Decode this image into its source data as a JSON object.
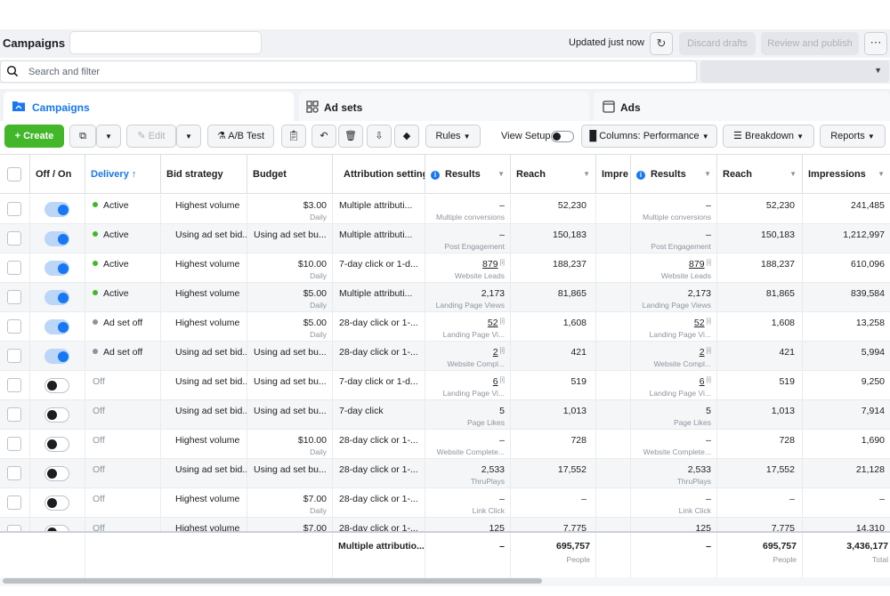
{
  "header": {
    "title": "Campaigns",
    "status": "Updated just now",
    "discard_label": "Discard drafts",
    "review_label": "Review and publish"
  },
  "search": {
    "placeholder": "Search and filter"
  },
  "tabs": [
    {
      "label": "Campaigns",
      "icon": "folder-icon",
      "active": true
    },
    {
      "label": "Ad sets",
      "icon": "grid-icon",
      "active": false
    },
    {
      "label": "Ads",
      "icon": "ad-icon",
      "active": false
    }
  ],
  "toolbar": {
    "create_label": "+ Create",
    "edit_label": "Edit",
    "ab_test_label": "A/B Test",
    "rules_label": "Rules",
    "view_setup_label": "View Setup",
    "columns_label": "Columns: Performance",
    "breakdown_label": "Breakdown",
    "reports_label": "Reports"
  },
  "columns": [
    "Off / On",
    "Delivery",
    "Bid strategy",
    "Budget",
    "Attribution setting",
    "Results",
    "Reach",
    "Impre",
    "Results",
    "Reach",
    "Impressions"
  ],
  "colors": {
    "accent": "#1877f2",
    "create": "#42b72a",
    "active_dot": "#42b72a",
    "off_dot": "#8d949e"
  },
  "rows": [
    {
      "on": true,
      "delivery": "Active",
      "bid": "Highest volume",
      "budget": "$3.00",
      "budget_sub": "Daily",
      "attr": "Multiple attributi...",
      "res": "–",
      "res_sub": "Multiple conversions",
      "reach": "52,230",
      "res2": "–",
      "res2_sub": "Multiple conversions",
      "reach2": "52,230",
      "impr": "241,485"
    },
    {
      "on": true,
      "delivery": "Active",
      "bid": "Using ad set bid...",
      "budget": "Using ad set bu...",
      "budget_sub": "",
      "attr": "Multiple attributi...",
      "res": "–",
      "res_sub": "Post Engagement",
      "reach": "150,183",
      "res2": "–",
      "res2_sub": "Post Engagement",
      "reach2": "150,183",
      "impr": "1,212,997"
    },
    {
      "on": true,
      "delivery": "Active",
      "bid": "Highest volume",
      "budget": "$10.00",
      "budget_sub": "Daily",
      "attr": "7-day click or 1-d...",
      "res": "879",
      "res_link": true,
      "res_sub": "Website Leads",
      "reach": "188,237",
      "res2": "879",
      "res2_sub": "Website Leads",
      "reach2": "188,237",
      "impr": "610,096"
    },
    {
      "on": true,
      "delivery": "Active",
      "bid": "Highest volume",
      "budget": "$5.00",
      "budget_sub": "Daily",
      "attr": "Multiple attributi...",
      "res": "2,173",
      "res_sub": "Landing Page Views",
      "reach": "81,865",
      "res2": "2,173",
      "res2_sub": "Landing Page Views",
      "reach2": "81,865",
      "impr": "839,584"
    },
    {
      "on": true,
      "delivery": "Ad set off",
      "bid": "Highest volume",
      "budget": "$5.00",
      "budget_sub": "Daily",
      "attr": "28-day click or 1-...",
      "res": "52",
      "res_link": true,
      "res_sub": "Landing Page Vi...",
      "reach": "1,608",
      "res2": "52",
      "res2_sub": "Landing Page Vi...",
      "reach2": "1,608",
      "impr": "13,258"
    },
    {
      "on": true,
      "delivery": "Ad set off",
      "bid": "Using ad set bid...",
      "budget": "Using ad set bu...",
      "budget_sub": "",
      "attr": "28-day click or 1-...",
      "res": "2",
      "res_link": true,
      "res_sub": "Website Compl...",
      "reach": "421",
      "res2": "2",
      "res2_sub": "Website Compl...",
      "reach2": "421",
      "impr": "5,994"
    },
    {
      "on": false,
      "delivery": "Off",
      "bid": "Using ad set bid...",
      "budget": "Using ad set bu...",
      "budget_sub": "",
      "attr": "7-day click or 1-d...",
      "res": "6",
      "res_link": true,
      "res_sub": "Landing Page Vi...",
      "reach": "519",
      "res2": "6",
      "res2_sub": "Landing Page Vi...",
      "reach2": "519",
      "impr": "9,250"
    },
    {
      "on": false,
      "delivery": "Off",
      "bid": "Using ad set bid...",
      "budget": "Using ad set bu...",
      "budget_sub": "",
      "attr": "7-day click",
      "res": "5",
      "res_sub": "Page Likes",
      "reach": "1,013",
      "res2": "5",
      "res2_sub": "Page Likes",
      "reach2": "1,013",
      "impr": "7,914"
    },
    {
      "on": false,
      "delivery": "Off",
      "bid": "Highest volume",
      "budget": "$10.00",
      "budget_sub": "Daily",
      "attr": "28-day click or 1-...",
      "res": "–",
      "res_sub": "Website Complete...",
      "reach": "728",
      "res2": "–",
      "res2_sub": "Website Complete...",
      "reach2": "728",
      "impr": "1,690"
    },
    {
      "on": false,
      "delivery": "Off",
      "bid": "Using ad set bid...",
      "budget": "Using ad set bu...",
      "budget_sub": "",
      "attr": "28-day click or 1-...",
      "res": "2,533",
      "res_sub": "ThruPlays",
      "reach": "17,552",
      "res2": "2,533",
      "res2_sub": "ThruPlays",
      "reach2": "17,552",
      "impr": "21,128"
    },
    {
      "on": false,
      "delivery": "Off",
      "bid": "Highest volume",
      "budget": "$7.00",
      "budget_sub": "Daily",
      "attr": "28-day click or 1-...",
      "res": "–",
      "res_sub": "Link Click",
      "reach": "–",
      "res2": "–",
      "res2_sub": "Link Click",
      "reach2": "–",
      "impr": "–"
    },
    {
      "on": false,
      "delivery": "Off",
      "bid": "Highest volume",
      "budget": "$7.00",
      "budget_sub": "",
      "attr": "28-day click or 1-...",
      "res": "125",
      "res_sub": "",
      "reach": "7,775",
      "res2": "125",
      "res2_sub": "",
      "reach2": "7,775",
      "impr": "14,310"
    }
  ],
  "totals": {
    "attr": "Multiple attributio...",
    "res": "–",
    "reach": "695,757",
    "reach_sub": "People",
    "res2": "–",
    "reach2": "695,757",
    "reach2_sub": "People",
    "impr": "3,436,177",
    "impr_sub": "Total"
  }
}
